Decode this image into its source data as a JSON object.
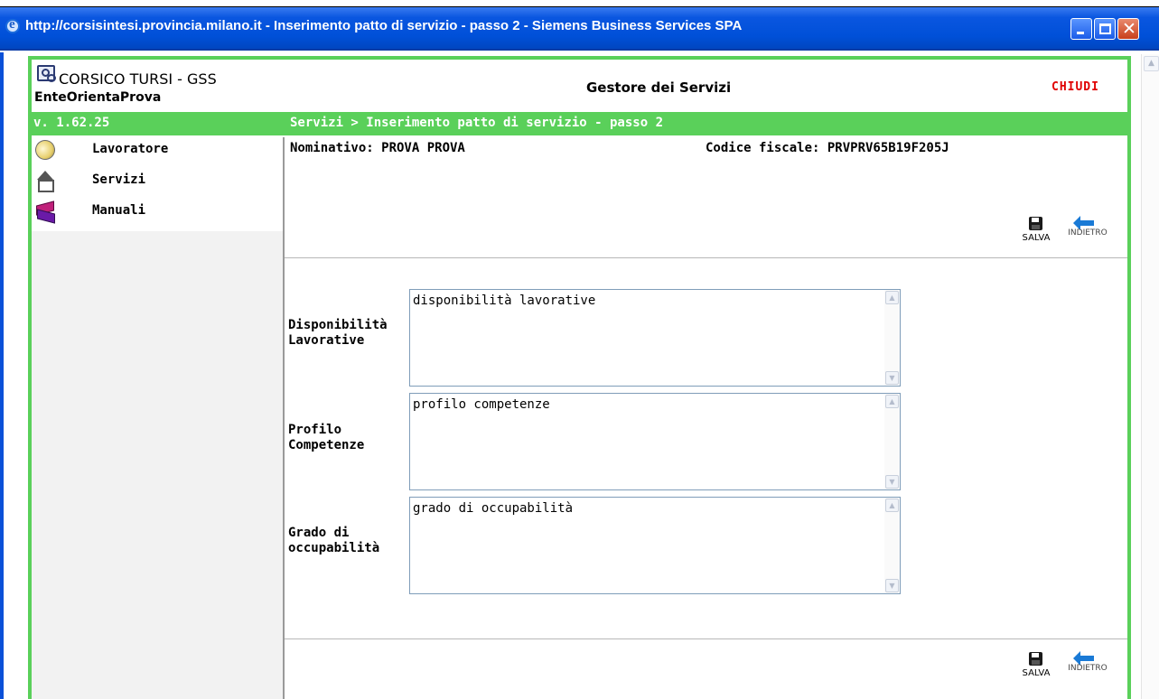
{
  "window": {
    "title": "http://corsisintesi.provincia.milano.it - Inserimento patto di servizio - passo 2 - Siemens Business Services SPA",
    "close_glyph": "✕"
  },
  "header": {
    "org_name": "CORSICO TURSI - GSS",
    "org_sub": "EnteOrientaProva",
    "app_title": "Gestore dei Servizi",
    "close_label": "CHIUDI"
  },
  "bar": {
    "version": "v. 1.62.25",
    "breadcrumb": "Servizi > Inserimento patto di servizio - passo 2"
  },
  "nav": {
    "items": [
      {
        "label": "Lavoratore",
        "icon": "worker-icon"
      },
      {
        "label": "Servizi",
        "icon": "services-house-icon"
      },
      {
        "label": "Manuali",
        "icon": "books-icon"
      }
    ]
  },
  "person": {
    "nominativo": "Nominativo: PROVA  PROVA",
    "codice_fiscale": "Codice fiscale: PRVPRV65B19F205J"
  },
  "actions": {
    "save_label": "SALVA",
    "back_label": "INDIETRO"
  },
  "fields": [
    {
      "label_line1": "Disponibilità",
      "label_line2": "Lavorative",
      "value": "disponibilità lavorative"
    },
    {
      "label_line1": "Profilo",
      "label_line2": "Competenze",
      "value": "profilo competenze"
    },
    {
      "label_line1": "Grado di",
      "label_line2": "occupabilità",
      "value": "grado di occupabilità"
    }
  ],
  "scroll_arrows": {
    "up": "▲",
    "down": "▼"
  },
  "colors": {
    "accent_green": "#5ad05a",
    "title_blue": "#0050d8",
    "close_red": "#e00000"
  }
}
